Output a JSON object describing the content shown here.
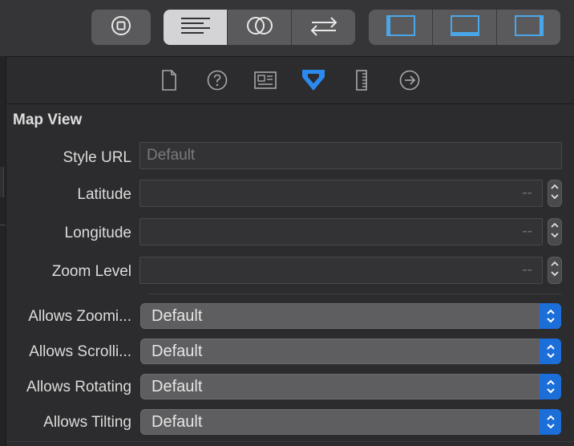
{
  "toolbar": {
    "stop_icon": "stop-circle-icon",
    "editor_modes": [
      {
        "icon": "text-lines-icon",
        "active": true
      },
      {
        "icon": "overlap-circles-icon",
        "active": false
      },
      {
        "icon": "swap-arrows-icon",
        "active": false
      }
    ],
    "panel_toggles": [
      {
        "icon": "left-panel-icon"
      },
      {
        "icon": "bottom-panel-icon"
      },
      {
        "icon": "right-panel-icon"
      }
    ],
    "accent_color": "#4aa6e8"
  },
  "inspector_tabs": [
    {
      "icon": "file-icon",
      "selected": false
    },
    {
      "icon": "help-icon",
      "selected": false
    },
    {
      "icon": "identity-icon",
      "selected": false
    },
    {
      "icon": "attributes-icon",
      "selected": true
    },
    {
      "icon": "ruler-icon",
      "selected": false
    },
    {
      "icon": "connections-icon",
      "selected": false
    }
  ],
  "section": {
    "title": "Map View"
  },
  "fields": {
    "style_url": {
      "label": "Style URL",
      "placeholder": "Default"
    },
    "latitude": {
      "label": "Latitude",
      "value": "--"
    },
    "longitude": {
      "label": "Longitude",
      "value": "--"
    },
    "zoom_level": {
      "label": "Zoom Level",
      "value": "--"
    }
  },
  "popups": [
    {
      "label": "Allows Zoomi...",
      "value": "Default"
    },
    {
      "label": "Allows Scrolli...",
      "value": "Default"
    },
    {
      "label": "Allows Rotating",
      "value": "Default"
    },
    {
      "label": "Allows Tilting",
      "value": "Default"
    }
  ]
}
